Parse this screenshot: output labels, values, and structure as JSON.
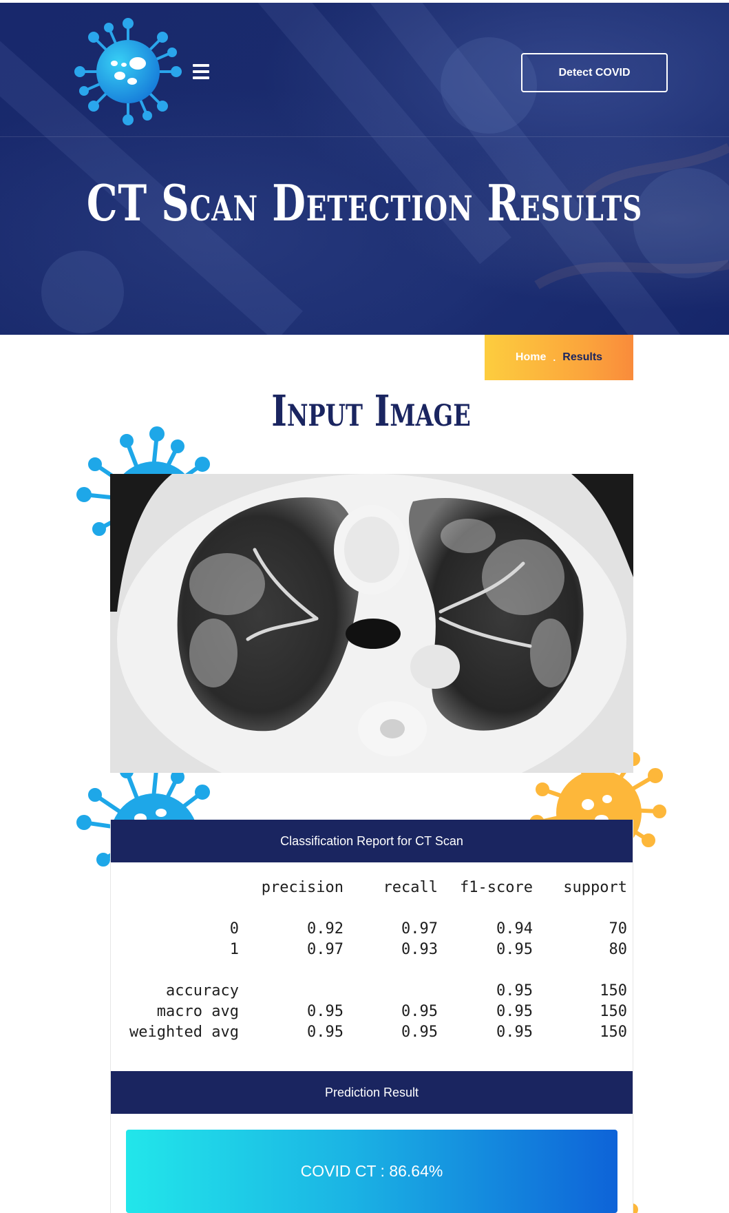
{
  "header": {
    "detect_button": "Detect COVID",
    "title": "CT Scan Detection Results"
  },
  "breadcrumb": {
    "home": "Home",
    "separator": ".",
    "current": "Results"
  },
  "section": {
    "title": "Input Image"
  },
  "report": {
    "title": "Classification Report for CT Scan",
    "columns": [
      "precision",
      "recall",
      "f1-score",
      "support"
    ],
    "rows": [
      {
        "label": "0",
        "precision": "0.92",
        "recall": "0.97",
        "f1": "0.94",
        "support": "70"
      },
      {
        "label": "1",
        "precision": "0.97",
        "recall": "0.93",
        "f1": "0.95",
        "support": "80"
      },
      {
        "label": "accuracy",
        "precision": "",
        "recall": "",
        "f1": "0.95",
        "support": "150"
      },
      {
        "label": "macro avg",
        "precision": "0.95",
        "recall": "0.95",
        "f1": "0.95",
        "support": "150"
      },
      {
        "label": "weighted avg",
        "precision": "0.95",
        "recall": "0.95",
        "f1": "0.95",
        "support": "150"
      }
    ]
  },
  "prediction": {
    "title": "Prediction Result",
    "value": "COVID CT : 86.64%"
  },
  "colors": {
    "navy": "#1a2560",
    "accent_yellow": "#fdcd3e",
    "accent_orange": "#f98b3b",
    "virus_blue": "#1ea7e8",
    "result_start": "#22e6ea",
    "result_end": "#0e63d8"
  }
}
